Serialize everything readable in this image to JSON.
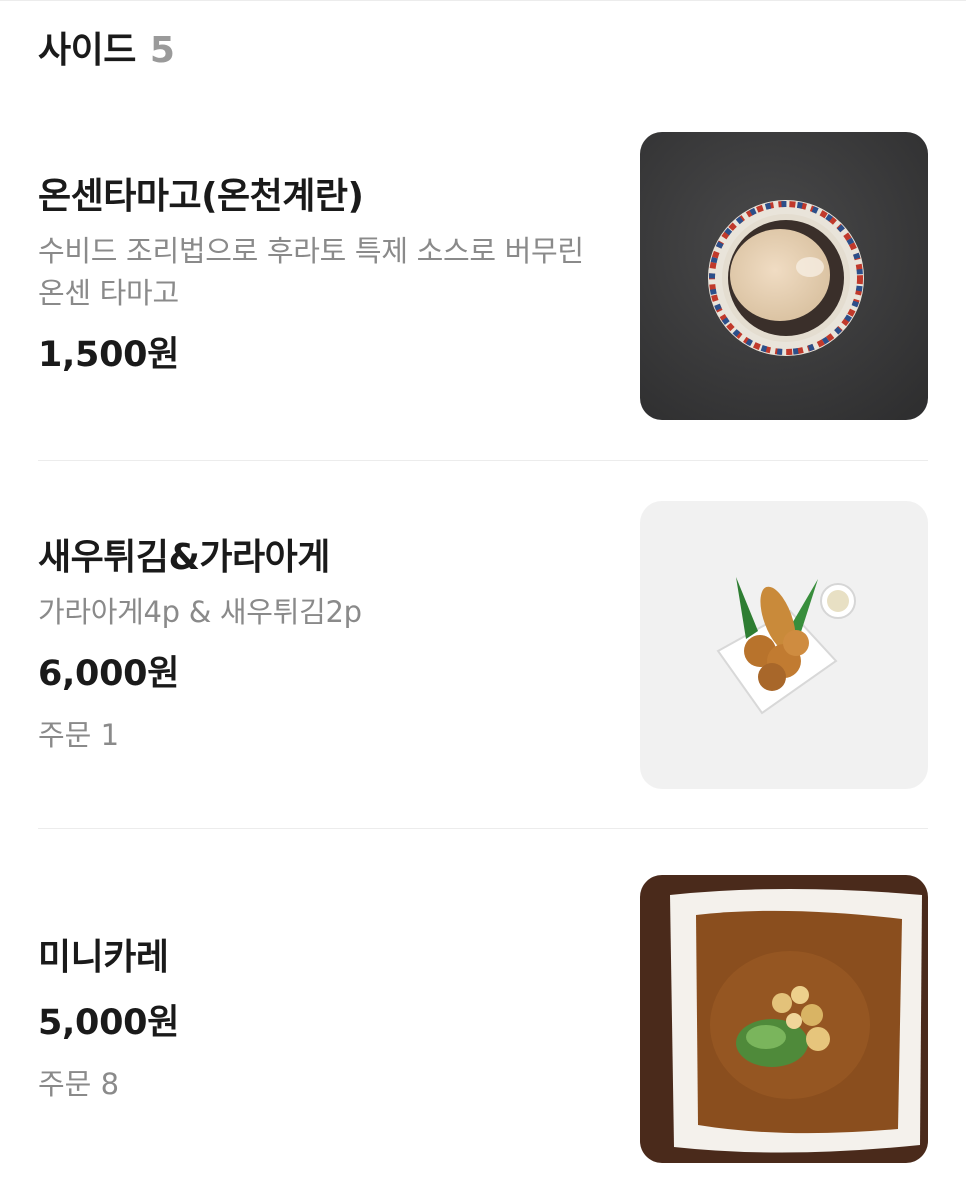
{
  "section": {
    "title": "사이드",
    "count": "5"
  },
  "items": [
    {
      "name": "온센타마고(온천계란)",
      "description": "수비드 조리법으로 후라토 특제 소스로 버무린 온센 타마고",
      "price": "1,500원",
      "orders": ""
    },
    {
      "name": "새우튀김&가라아게",
      "description": "가라아게4p & 새우튀김2p",
      "price": "6,000원",
      "orders": "주문 1"
    },
    {
      "name": "미니카레",
      "description": "",
      "price": "5,000원",
      "orders": "주문 8"
    }
  ],
  "colors": {
    "text_primary": "#1a1a1a",
    "text_secondary": "#8a8a8a",
    "divider": "#ececec",
    "count": "#9a9a9a"
  }
}
